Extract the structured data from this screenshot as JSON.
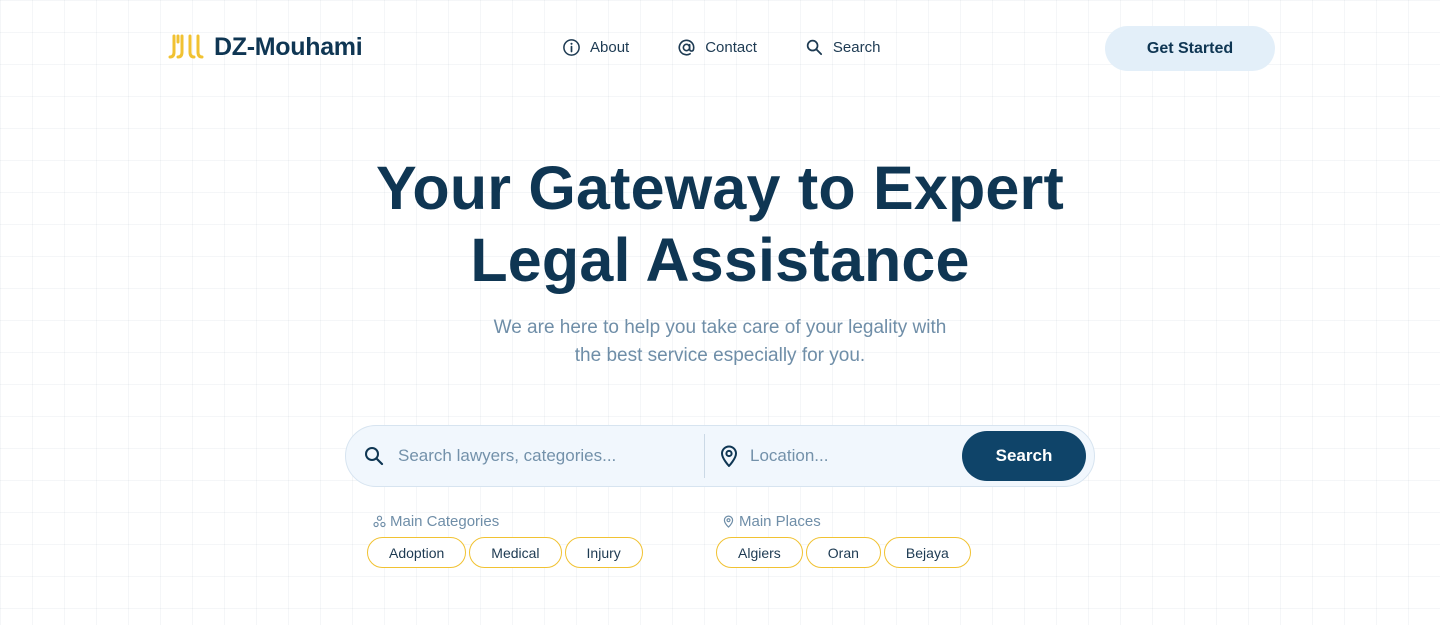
{
  "brand": {
    "name": "DZ-Mouhami",
    "logo_icon": "scales-logo-icon",
    "colors": {
      "primary": "#0f3653",
      "accent": "#f1c232",
      "button": "#0f4469",
      "soft": "#e3eff9"
    }
  },
  "nav": {
    "items": [
      {
        "label": "About",
        "icon": "info-icon"
      },
      {
        "label": "Contact",
        "icon": "at-icon"
      },
      {
        "label": "Search",
        "icon": "search-icon"
      }
    ],
    "cta_label": "Get Started"
  },
  "hero": {
    "title_line1": "Your Gateway to Expert",
    "title_line2": "Legal Assistance",
    "subtitle_line1": "We are here to help you take care of your legality with",
    "subtitle_line2": "the best service especially for you."
  },
  "search": {
    "query_placeholder": "Search lawyers, categories...",
    "query_value": "",
    "location_placeholder": "Location...",
    "location_value": "",
    "button_label": "Search"
  },
  "categories": {
    "heading": "Main Categories",
    "icon": "categories-icon",
    "items": [
      "Adoption",
      "Medical",
      "Injury"
    ]
  },
  "places": {
    "heading": "Main Places",
    "icon": "map-pin-icon",
    "items": [
      "Algiers",
      "Oran",
      "Bejaya"
    ]
  }
}
